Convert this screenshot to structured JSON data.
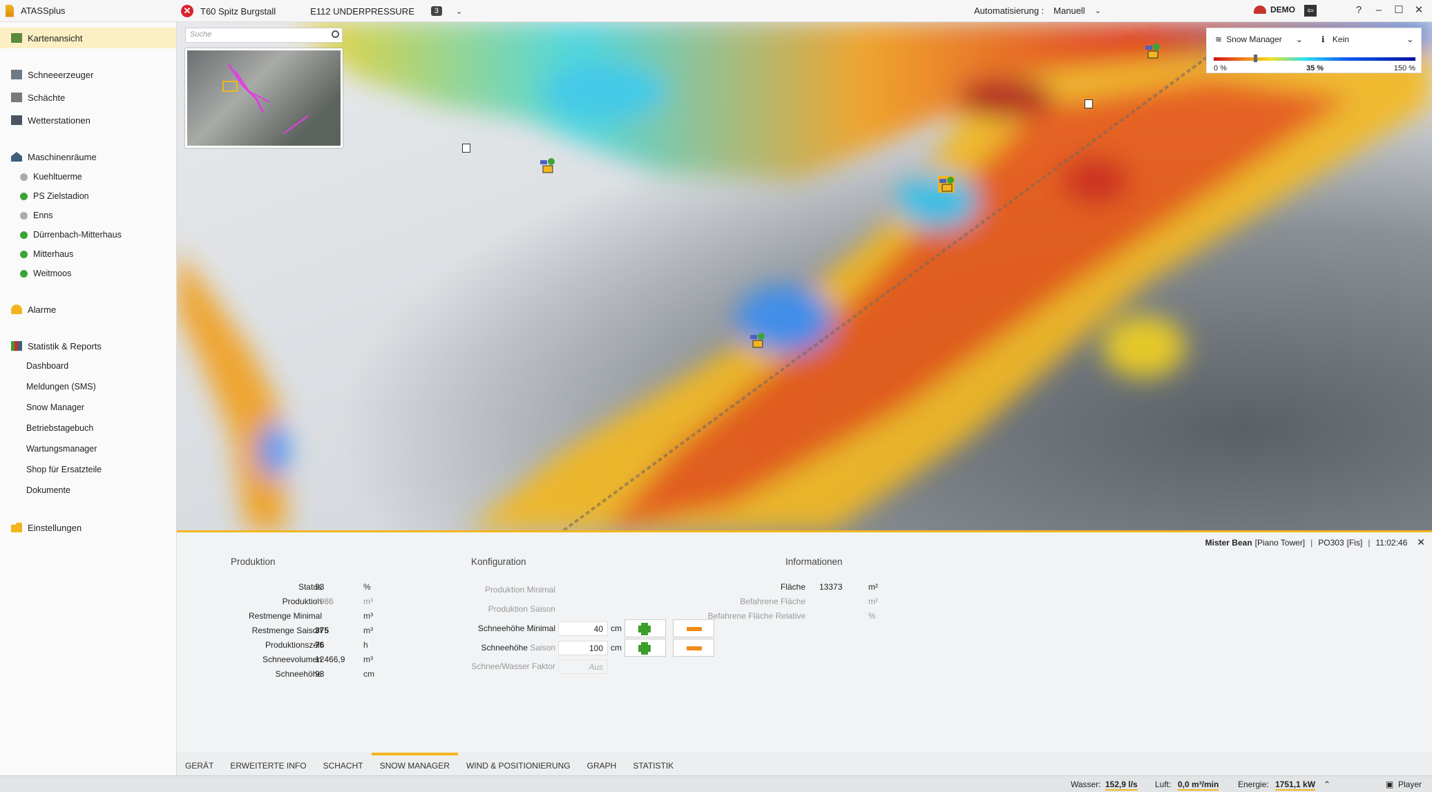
{
  "app": {
    "title": "ATASSplus"
  },
  "alarm": {
    "name": "T60 Spitz Burgstall",
    "code": "E112 UNDERPRESSURE",
    "count": "3"
  },
  "automation": {
    "label": "Automatisierung :",
    "value": "Manuell"
  },
  "user": {
    "name": "DEMO"
  },
  "window": {
    "help": "?",
    "minimize": "–",
    "maximize": "☐",
    "close": "✕"
  },
  "sidebar": {
    "kartenansicht": "Kartenansicht",
    "schneeerzeuger": "Schneeerzeuger",
    "schaechte": "Schächte",
    "wetterstationen": "Wetterstationen",
    "maschinenraeume": "Maschinenräume",
    "rooms": [
      {
        "label": "Kuehltuerme",
        "status": "grey"
      },
      {
        "label": "PS Zielstadion",
        "status": "green"
      },
      {
        "label": "Enns",
        "status": "grey"
      },
      {
        "label": "Dürrenbach-Mitterhaus",
        "status": "green"
      },
      {
        "label": "Mitterhaus",
        "status": "green"
      },
      {
        "label": "Weitmoos",
        "status": "green"
      }
    ],
    "alarme": "Alarme",
    "statistik": "Statistik & Reports",
    "reports": [
      "Dashboard",
      "Meldungen (SMS)",
      "Snow Manager",
      "Betriebstagebuch",
      "Wartungsmanager",
      "Shop für Ersatzteile",
      "Dokumente"
    ],
    "einstellungen": "Einstellungen"
  },
  "map": {
    "search_placeholder": "Suche",
    "layer": "Snow Manager",
    "info": "Kein",
    "legend_min": "0 %",
    "legend_mid": "35 %",
    "legend_max": "150 %",
    "legend_value": 0.35
  },
  "detail": {
    "device": "Mister Bean",
    "type": "[Piano Tower]",
    "id": "PO303",
    "fis": "[Fis]",
    "time": "11:02:46",
    "produktion": {
      "title": "Produktion",
      "rows": [
        {
          "label": "Status",
          "value": "93",
          "unit": "%"
        },
        {
          "label": "Produktion",
          "value": "4986",
          "unit": "m³"
        },
        {
          "label": "Restmenge Minimal",
          "value": "",
          "unit": "m³"
        },
        {
          "label": "Restmenge Saison",
          "value": "375",
          "unit": "m³"
        },
        {
          "label": "Produktionszeit",
          "value": "76",
          "unit": "h"
        },
        {
          "label": "Schneevolumen",
          "value": "12466,9",
          "unit": "m³"
        },
        {
          "label": "Schneehöhe",
          "value": "93",
          "unit": "cm"
        }
      ]
    },
    "konfiguration": {
      "title": "Konfiguration",
      "prod_min": "Produktion Minimal",
      "prod_saison": "Produktion Saison",
      "sh_min_label": "Schneehöhe Minimal",
      "sh_min_value": "40",
      "sh_saison_label": "Schneehöhe",
      "sh_saison_sub": "Saison",
      "sh_saison_value": "100",
      "unit": "cm",
      "faktor_label": "Schnee/Wasser Faktor",
      "faktor_value": "Aus"
    },
    "informationen": {
      "title": "Informationen",
      "rows": [
        {
          "label": "Fläche",
          "value": "13373",
          "unit": "m²"
        },
        {
          "label": "Befahrene Fläche",
          "value": "",
          "unit": "m²"
        },
        {
          "label": "Befahrene Fläche Relative",
          "value": "",
          "unit": "%"
        }
      ]
    }
  },
  "tabs": [
    "GERÄT",
    "ERWEITERTE INFO",
    "SCHACHT",
    "SNOW MANAGER",
    "WIND & POSITIONIERUNG",
    "GRAPH",
    "STATISTIK"
  ],
  "status": {
    "wasser_label": "Wasser:",
    "wasser": "152,9 l/s",
    "luft_label": "Luft:",
    "luft": "0,0 m³/min",
    "energie_label": "Energie:",
    "energie": "1751,1 kW",
    "player": "Player"
  }
}
